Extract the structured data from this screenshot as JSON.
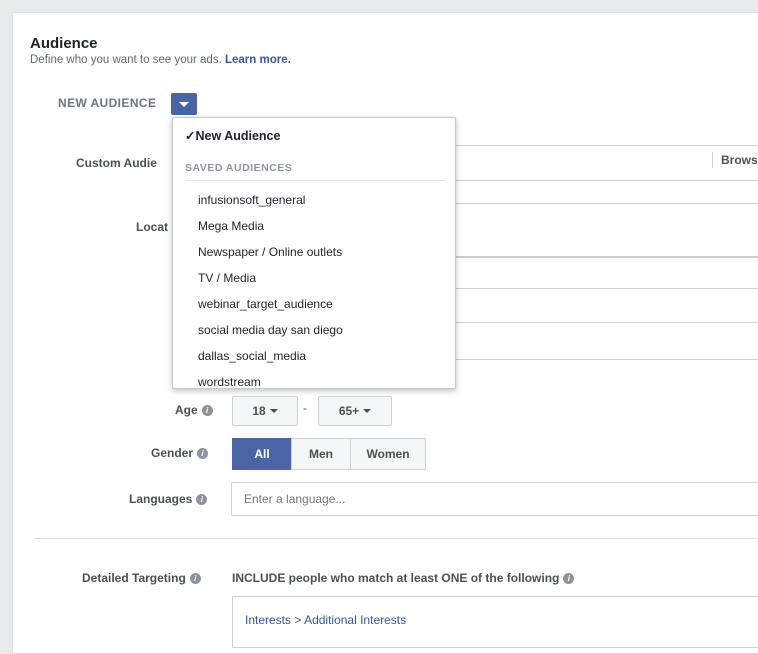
{
  "audience": {
    "title": "Audience",
    "subtitle": "Define who you want to see your ads.",
    "learn_more": "Learn more."
  },
  "new_audience": {
    "label": "NEW AUDIENCE"
  },
  "fields": {
    "custom_audiences_label": "Custom Audie",
    "browse_label": "Brows",
    "locations_label": "Locat",
    "age_label": "Age",
    "age_min": "18",
    "age_max": "65+",
    "age_separator": "-",
    "gender_label": "Gender",
    "gender_options": [
      "All",
      "Men",
      "Women"
    ],
    "gender_selected": "All",
    "languages_label": "Languages",
    "languages_placeholder": "Enter a language...",
    "detailed_targeting_label": "Detailed Targeting",
    "include_text": "INCLUDE people who match at least ONE of the following",
    "interests_link": "Interests",
    "interests_sep": ">",
    "additional_interests_link": "Additional Interests"
  },
  "dropdown": {
    "checked_item": "New Audience",
    "section_header": "SAVED AUDIENCES",
    "items": [
      "infusionsoft_general",
      "Mega Media",
      "Newspaper / Online outlets",
      "TV / Media",
      "webinar_target_audience",
      "social media day san diego",
      "dallas_social_media",
      "wordstream"
    ]
  },
  "colors": {
    "accent": "#4b64a6",
    "link": "#365899",
    "page_bg": "#e9ebee"
  },
  "icons": [
    "info-icon",
    "chevron-down-icon",
    "check-icon"
  ]
}
